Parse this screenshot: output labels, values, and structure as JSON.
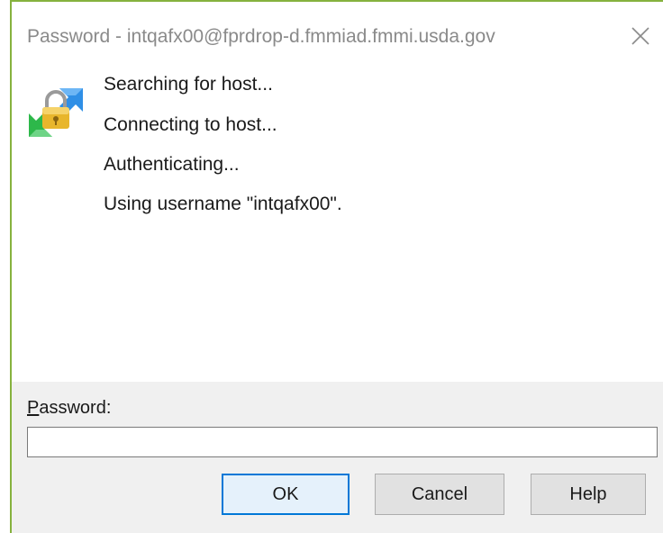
{
  "window": {
    "title": "Password - intqafx00@fprdrop-d.fmmiad.fmmi.usda.gov",
    "accent_color": "#86b23e",
    "close_icon": "close-icon"
  },
  "app_icon": "padlock-transfer-icon",
  "log": [
    "Searching for host...",
    "Connecting to host...",
    "Authenticating...",
    "Using username \"intqafx00\"."
  ],
  "password": {
    "label_access_key": "P",
    "label_rest": "assword:",
    "value": ""
  },
  "buttons": {
    "ok": "OK",
    "cancel": "Cancel",
    "help": "Help"
  },
  "colors": {
    "default_button_border": "#0078d7",
    "panel_background": "#f0f0f0"
  }
}
